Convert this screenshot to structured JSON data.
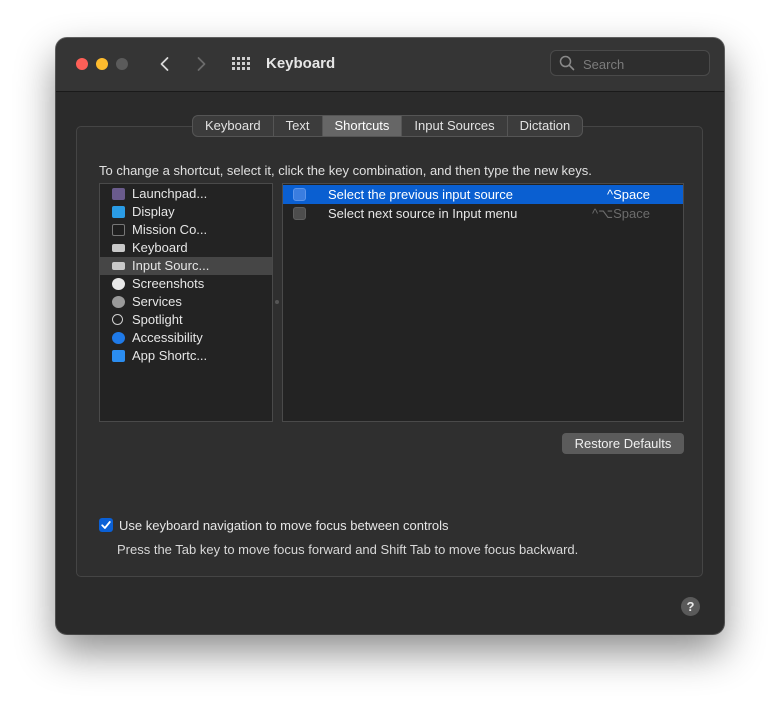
{
  "window": {
    "title": "Keyboard",
    "search_placeholder": "Search"
  },
  "tabs": [
    {
      "label": "Keyboard",
      "active": false
    },
    {
      "label": "Text",
      "active": false
    },
    {
      "label": "Shortcuts",
      "active": true
    },
    {
      "label": "Input Sources",
      "active": false
    },
    {
      "label": "Dictation",
      "active": false
    }
  ],
  "instructions": "To change a shortcut, select it, click the key combination, and then type the new keys.",
  "categories": [
    {
      "label": "Launchpad...",
      "icon": "launchpad-icon",
      "color": "#6a5b8c",
      "selected": false
    },
    {
      "label": "Display",
      "icon": "display-icon",
      "color": "#2a9ce6",
      "selected": false
    },
    {
      "label": "Mission Co...",
      "icon": "mission-control-icon",
      "color": "#1f1f1f",
      "selected": false
    },
    {
      "label": "Keyboard",
      "icon": "keyboard-icon",
      "color": "#c9c9c9",
      "selected": false
    },
    {
      "label": "Input Sourc...",
      "icon": "input-sources-icon",
      "color": "#c9c9c9",
      "selected": true
    },
    {
      "label": "Screenshots",
      "icon": "screenshot-icon",
      "color": "#e8e8e8",
      "selected": false
    },
    {
      "label": "Services",
      "icon": "gear-icon",
      "color": "#9a9a9a",
      "selected": false
    },
    {
      "label": "Spotlight",
      "icon": "spotlight-icon",
      "color": "#3a3a3a",
      "selected": false
    },
    {
      "label": "Accessibility",
      "icon": "accessibility-icon",
      "color": "#1f7ae8",
      "selected": false
    },
    {
      "label": "App Shortc...",
      "icon": "app-store-icon",
      "color": "#2b8df0",
      "selected": false
    }
  ],
  "shortcuts": [
    {
      "name": "Select the previous input source",
      "keys": "^Space",
      "checked": false,
      "selected": true,
      "enabled": true
    },
    {
      "name": "Select next source in Input menu",
      "keys": "^⌥Space",
      "checked": false,
      "selected": false,
      "enabled": false
    }
  ],
  "restore_button": "Restore Defaults",
  "keyboard_navigation": {
    "checked": true,
    "label": "Use keyboard navigation to move focus between controls",
    "help": "Press the Tab key to move focus forward and Shift Tab to move focus backward."
  },
  "help_button": "?",
  "colors": {
    "accent": "#0a5fd1",
    "close": "#fe5f57",
    "minimize": "#febc2e",
    "window_bg": "#2b2b2b"
  }
}
